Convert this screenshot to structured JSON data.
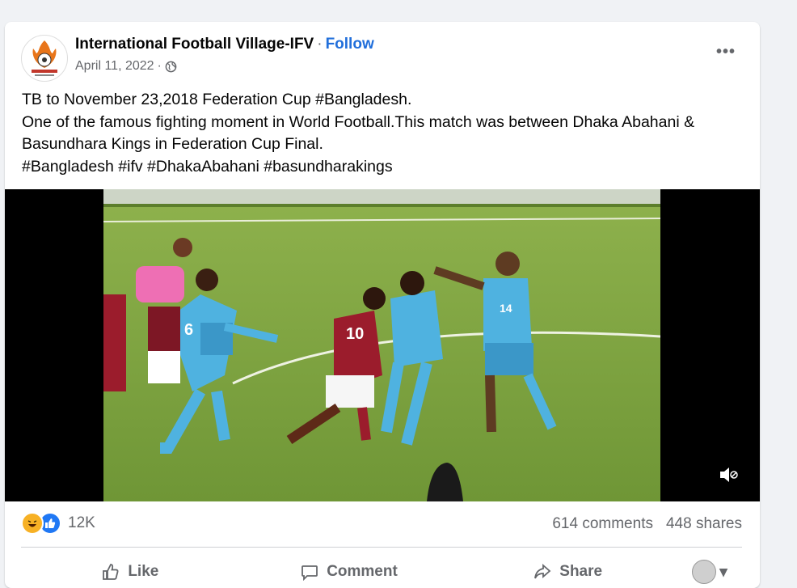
{
  "post": {
    "page_name": "International Football Village-IFV",
    "separator": "·",
    "follow_label": "Follow",
    "date": "April 11, 2022",
    "meta_separator": "·",
    "audience_icon": "globe-icon",
    "more_label": "•••",
    "text": "TB to November 23,2018 Federation Cup #Bangladesh.\nOne of the famous fighting moment in World Football.This match was between Dhaka Abahani & Basundhara Kings in Federation Cup Final.\n #Bangladesh #ifv #DhakaAbahani #basundharakings"
  },
  "video": {
    "mute_icon": "speaker-muted-icon",
    "players": [
      {
        "number": "10"
      },
      {
        "number": "14"
      },
      {
        "number": "6"
      }
    ]
  },
  "engagement": {
    "reactions": [
      "haha-icon",
      "like-icon"
    ],
    "reaction_count": "12K",
    "comments": "614 comments",
    "shares": "448 shares"
  },
  "actions": {
    "like": "Like",
    "comment": "Comment",
    "share": "Share",
    "profile_caret": "▾"
  },
  "colors": {
    "brand_blue": "#216fdb",
    "secondary_text": "#65676b",
    "pitch": "#7fa53e",
    "kit_blue": "#4fb2e0",
    "kit_red": "#9b1c2c"
  }
}
